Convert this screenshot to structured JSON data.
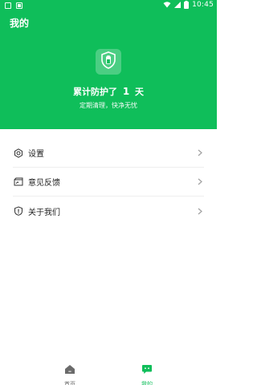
{
  "colors": {
    "brand": "#0fbe5a",
    "text": "#222222",
    "muted": "#666666",
    "chevron": "#a0a0a0"
  },
  "status_bar": {
    "time": "10:45",
    "icons": [
      "notification-icon",
      "android-icon",
      "wifi-icon",
      "signal-icon",
      "battery-icon"
    ]
  },
  "header": {
    "title": "我的",
    "protect_prefix": "累计防护了",
    "protect_days": "1",
    "protect_suffix": "天",
    "subtext": "定期清理，快净无忧",
    "icon": "shield-icon"
  },
  "menu": {
    "items": [
      {
        "label": "设置",
        "icon": "gear-icon"
      },
      {
        "label": "意见反馈",
        "icon": "feedback-icon"
      },
      {
        "label": "关于我们",
        "icon": "info-shield-icon"
      }
    ],
    "chevron_icon": "chevron-right-icon"
  },
  "bottom_nav": {
    "items": [
      {
        "label": "首页",
        "icon": "home-icon",
        "active": false
      },
      {
        "label": "我的",
        "icon": "chat-icon",
        "active": true
      }
    ]
  }
}
